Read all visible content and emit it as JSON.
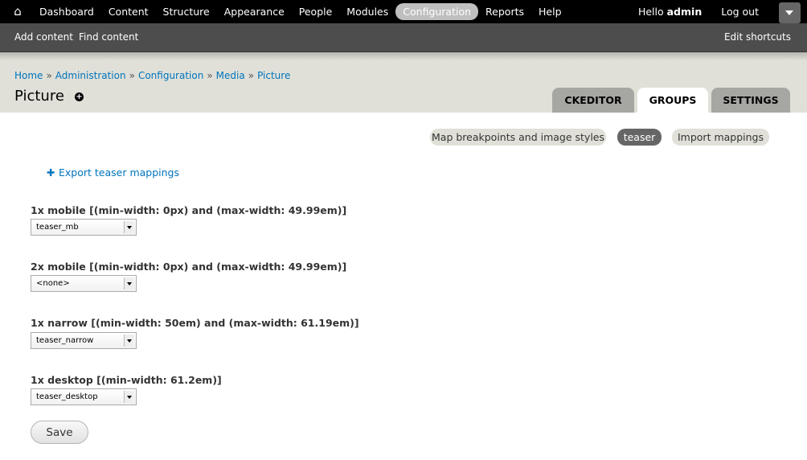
{
  "toolbar": {
    "home_icon": "home-icon",
    "menu": [
      "Dashboard",
      "Content",
      "Structure",
      "Appearance",
      "People",
      "Modules",
      "Configuration",
      "Reports",
      "Help"
    ],
    "active": "Configuration",
    "hello_prefix": "Hello ",
    "username": "admin",
    "logout": "Log out"
  },
  "shortcuts": {
    "add_content": "Add content",
    "find_content": "Find content",
    "edit_shortcuts": "Edit shortcuts"
  },
  "breadcrumb": [
    "Home",
    "Administration",
    "Configuration",
    "Media",
    "Picture"
  ],
  "breadcrumb_separator": "»",
  "page_title": "Picture",
  "tabs": [
    "CKEDITOR",
    "GROUPS",
    "SETTINGS"
  ],
  "active_tab": "GROUPS",
  "subtabs": [
    "Map breakpoints and image styles",
    "teaser",
    "Import mappings"
  ],
  "active_subtab": "teaser",
  "export_link": "Export teaser mappings",
  "fields": [
    {
      "label": "1x mobile [(min-width: 0px) and (max-width: 49.99em)]",
      "value": "teaser_mb"
    },
    {
      "label": "2x mobile [(min-width: 0px) and (max-width: 49.99em)]",
      "value": "<none>"
    },
    {
      "label": "1x narrow [(min-width: 50em) and (max-width: 61.19em)]",
      "value": "teaser_narrow"
    },
    {
      "label": "1x desktop [(min-width: 61.2em)]",
      "value": "teaser_desktop"
    }
  ],
  "save_label": "Save",
  "colors": {
    "link": "#0074bd",
    "toolbar": "#000000",
    "shortcuts": "#4d4d4d",
    "header": "#e0e0d8"
  }
}
